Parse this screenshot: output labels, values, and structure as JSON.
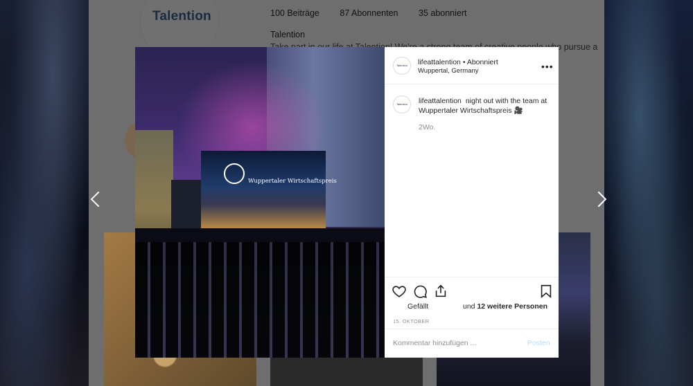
{
  "profile": {
    "logo_text": "Talention",
    "stats": {
      "posts": "100 Beiträge",
      "followers": "87 Abonnenten",
      "following": "35 abonniert"
    },
    "name": "Talention",
    "bio": "Take part in our life at Talention! We're a strong team of creative people who pursue a"
  },
  "photo": {
    "screen_title": "Wuppertaler Wirtschaftspreis"
  },
  "post": {
    "header": {
      "username": "lifeattalention",
      "separator": "•",
      "follow_status": "Abonniert",
      "location": "Wuppertal, Germany",
      "more": "•••"
    },
    "avatar_text": "Talention",
    "caption": {
      "username": "lifeattalention",
      "text": "night out with the team at Wuppertaler Wirtschaftspreis 🎥",
      "time": "2Wo."
    },
    "likes": {
      "label": "Gefällt",
      "prefix": "und",
      "count_text": "12 weitere Personen"
    },
    "date": "15. OKTOBER",
    "comment": {
      "placeholder": "Kommentar hinzufügen ...",
      "post_label": "Posten"
    }
  },
  "colors": {
    "accent": "#b2dffc",
    "text": "#262626",
    "muted": "#8e8e8e"
  },
  "icons": [
    "chevron-left-icon",
    "chevron-right-icon",
    "heart-icon",
    "comment-icon",
    "share-icon",
    "bookmark-icon",
    "more-icon"
  ]
}
